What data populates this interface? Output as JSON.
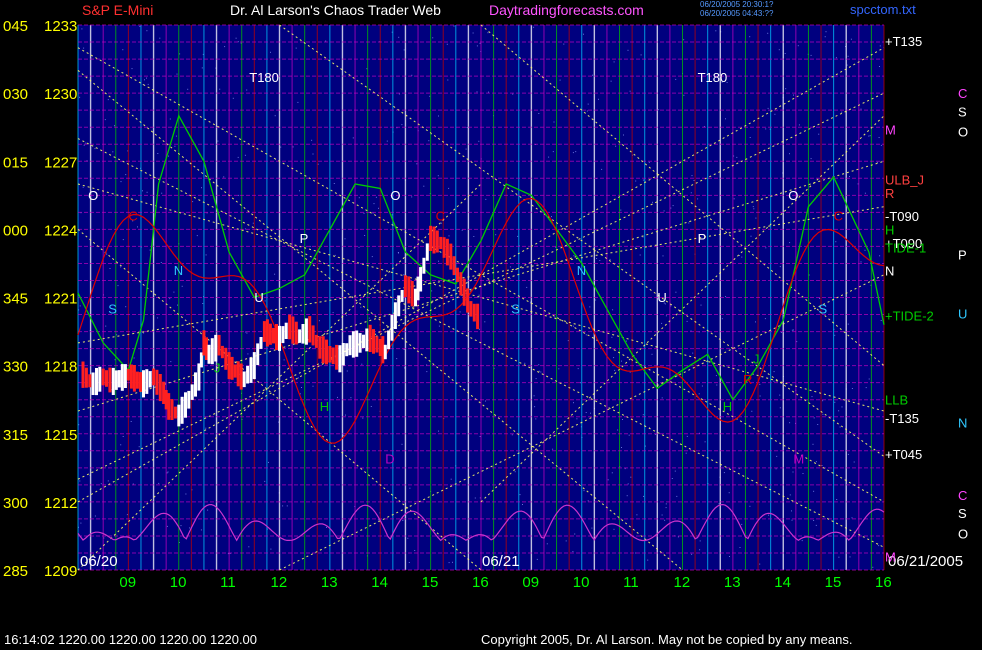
{
  "header": {
    "instrument": "S&P E-Mini",
    "title": "Dr. Al Larson's Chaos Trader Web",
    "site": "Daytradingforecasts.com",
    "filename": "spcctom.txt",
    "stamp_lines": [
      "06/20/2005 20:30:1?",
      "06/20/2005 04:43:??"
    ]
  },
  "footer": {
    "quote": "16:14:02  1220.00 1220.00 1220.00 1220.00",
    "copyright": "Copyright 2005, Dr. Al Larson. May not be copied by any means."
  },
  "colors": {
    "background": "#00007f",
    "price_up": "#ffffff",
    "price_down": "#ff2020",
    "angle_lines": "#ffff66",
    "grid_green": "#00c000",
    "grid_red": "#c00000",
    "grid_cyan": "#00c8ff",
    "grid_magenta": "#c000c0",
    "tide": "#00cc00",
    "red_curve": "#e00000",
    "osc": "#cc33cc"
  },
  "chart_data": {
    "type": "line",
    "title": "S&P E-Mini",
    "ylim": [
      1209,
      1233
    ],
    "y_ticks": [
      {
        "angle": "045",
        "price": "1233"
      },
      {
        "angle": "030",
        "price": "1230"
      },
      {
        "angle": "015",
        "price": "1227"
      },
      {
        "angle": "000",
        "price": "1224"
      },
      {
        "angle": "345",
        "price": "1221"
      },
      {
        "angle": "330",
        "price": "1218"
      },
      {
        "angle": "315",
        "price": "1215"
      },
      {
        "angle": "300",
        "price": "1212"
      },
      {
        "angle": "285",
        "price": "1209"
      }
    ],
    "x_hours": [
      "09",
      "10",
      "11",
      "12",
      "13",
      "14",
      "15",
      "16",
      "09",
      "10",
      "11",
      "12",
      "13",
      "14",
      "15",
      "16"
    ],
    "date_labels": [
      "06/20",
      "06/21",
      "06/21/2005"
    ],
    "price_series": {
      "name": "S&P E-Mini",
      "x": [
        8.1,
        8.3,
        8.5,
        8.7,
        9.0,
        9.3,
        9.5,
        9.7,
        9.8,
        10.0,
        10.2,
        10.4,
        10.5,
        10.6,
        10.8,
        11.0,
        11.3,
        11.5,
        11.7,
        12.0,
        12.2,
        12.4,
        12.6,
        12.8,
        13.0,
        13.2,
        13.4,
        13.6,
        13.8,
        14.0,
        14.1,
        14.3,
        14.5,
        14.7,
        14.8,
        15.0,
        15.2,
        15.4,
        15.6,
        15.8,
        16.0
      ],
      "y": [
        1217.6,
        1217.2,
        1217.5,
        1217.3,
        1217.6,
        1217.2,
        1217.5,
        1216.8,
        1216.2,
        1215.8,
        1216.5,
        1217.5,
        1219.0,
        1218.5,
        1218.9,
        1218.0,
        1217.4,
        1218.0,
        1219.5,
        1219.2,
        1219.7,
        1219.3,
        1219.6,
        1218.8,
        1218.5,
        1218.3,
        1218.9,
        1219.0,
        1219.2,
        1218.8,
        1218.6,
        1220.2,
        1221.5,
        1221.0,
        1221.8,
        1223.6,
        1223.4,
        1222.8,
        1221.6,
        1220.5,
        1220.0
      ]
    },
    "tide_series": {
      "name": "TIDE",
      "x": [
        8.0,
        8.5,
        9.0,
        9.3,
        9.6,
        10.0,
        10.5,
        11.0,
        11.5,
        12.0,
        12.5,
        13.0,
        13.5,
        14.0,
        14.5,
        15.0,
        15.5,
        16.0,
        16.5,
        17.0,
        17.5,
        18.0,
        18.5,
        19.0,
        19.5,
        20.0,
        20.5,
        21.0,
        21.5,
        22.0,
        22.5,
        23.0,
        23.7,
        24.0
      ],
      "y": [
        1221.2,
        1219.0,
        1217.8,
        1220.0,
        1226.0,
        1229.0,
        1227.0,
        1223.0,
        1221.0,
        1221.4,
        1222.0,
        1224.0,
        1226.0,
        1225.8,
        1223.0,
        1222.0,
        1221.6,
        1223.5,
        1226.0,
        1225.5,
        1224.0,
        1222.5,
        1220.5,
        1218.5,
        1217.0,
        1217.8,
        1218.5,
        1216.5,
        1218.0,
        1220.0,
        1225.0,
        1226.3,
        1223.0,
        1219.8
      ]
    },
    "right_labels": [
      {
        "text": "+T135",
        "price": 1232.3
      },
      {
        "text": "M",
        "price": 1228.4
      },
      {
        "text": "ULB_J",
        "price": 1226.2
      },
      {
        "text": "R",
        "price": 1225.6
      },
      {
        "text": "-T090",
        "price": 1224.6
      },
      {
        "text": "H",
        "price": 1224.0
      },
      {
        "text": "+T090",
        "price": 1223.4
      },
      {
        "text": "TIDE-1",
        "price": 1223.2
      },
      {
        "text": "N",
        "price": 1222.2
      },
      {
        "text": "+TIDE-2",
        "price": 1220.2
      },
      {
        "text": "LLB",
        "price": 1216.5
      },
      {
        "text": "-T135",
        "price": 1215.7
      },
      {
        "text": "+T045",
        "price": 1214.1
      },
      {
        "text": "M",
        "price": 1209.6
      }
    ],
    "far_right_labels": [
      {
        "text": "C",
        "price": 1230.0
      },
      {
        "text": "S",
        "price": 1229.2
      },
      {
        "text": "O",
        "price": 1228.3
      },
      {
        "text": "P",
        "price": 1222.9
      },
      {
        "text": "U",
        "price": 1220.3
      },
      {
        "text": "N",
        "price": 1215.5
      },
      {
        "text": "C",
        "price": 1212.3
      },
      {
        "text": "S",
        "price": 1211.5
      },
      {
        "text": "O",
        "price": 1210.6
      }
    ],
    "in_chart_labels": [
      {
        "text": "T180",
        "x": 11.4,
        "price": 1230.5
      },
      {
        "text": "T180",
        "x": 20.3,
        "price": 1230.5
      },
      {
        "text": "O",
        "x": 8.2,
        "price": 1225.3
      },
      {
        "text": "C",
        "x": 9.0,
        "price": 1224.4
      },
      {
        "text": "N",
        "x": 9.9,
        "price": 1222.0
      },
      {
        "text": "S",
        "x": 8.6,
        "price": 1220.3
      },
      {
        "text": "P",
        "x": 12.4,
        "price": 1223.4
      },
      {
        "text": "O",
        "x": 14.2,
        "price": 1225.3
      },
      {
        "text": "U",
        "x": 11.5,
        "price": 1220.8
      },
      {
        "text": "H",
        "x": 12.8,
        "price": 1216.0
      },
      {
        "text": "J",
        "x": 10.7,
        "price": 1217.7
      },
      {
        "text": "C",
        "x": 15.1,
        "price": 1224.4
      },
      {
        "text": "S",
        "x": 16.6,
        "price": 1220.3
      },
      {
        "text": "N",
        "x": 17.9,
        "price": 1222.0
      },
      {
        "text": "U",
        "x": 19.5,
        "price": 1220.8
      },
      {
        "text": "P",
        "x": 20.3,
        "price": 1223.4
      },
      {
        "text": "H",
        "x": 20.8,
        "price": 1216.0
      },
      {
        "text": "J",
        "x": 21.4,
        "price": 1218.1
      },
      {
        "text": "R",
        "x": 21.2,
        "price": 1217.2
      },
      {
        "text": "O",
        "x": 22.1,
        "price": 1225.3
      },
      {
        "text": "S",
        "x": 22.7,
        "price": 1220.3
      },
      {
        "text": "M",
        "x": 22.2,
        "price": 1213.7
      },
      {
        "text": "D",
        "x": 14.1,
        "price": 1213.7
      },
      {
        "text": "C",
        "x": 23.0,
        "price": 1224.4
      }
    ]
  }
}
